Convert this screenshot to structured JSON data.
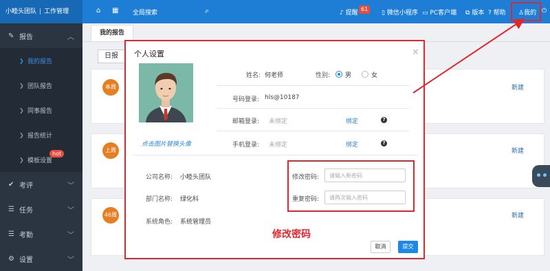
{
  "topbar": {
    "brand": "小睦头团队",
    "brand_sub": "工作管理",
    "search_label": "全局搜索",
    "remind_label": "提醒",
    "remind_count": "61",
    "wechat_label": "微信小程序",
    "pc_label": "PC客户端",
    "version_label": "版本",
    "help_label": "帮助",
    "mine_label": "我的"
  },
  "sidebar": {
    "groups": [
      {
        "label": "报告",
        "icon": "edit-icon"
      },
      {
        "label": "考评",
        "icon": "check-icon"
      },
      {
        "label": "任务",
        "icon": "list-icon"
      },
      {
        "label": "考勤",
        "icon": "list-icon"
      },
      {
        "label": "设置",
        "icon": "gear-icon"
      }
    ],
    "sub_items": [
      "我的报告",
      "团队报告",
      "同事报告",
      "报告统计",
      "模板设置"
    ],
    "hot_badge": "hot"
  },
  "main": {
    "tab": "我的报告",
    "daily_button": "日报",
    "cards": [
      {
        "week": "本周",
        "action": "新建"
      },
      {
        "week": "上周",
        "action": "新建"
      },
      {
        "week": "46周",
        "action": "新建"
      }
    ]
  },
  "modal": {
    "title": "个人设置",
    "avatar_hint": "点击图片替换头像",
    "name_label": "姓名:",
    "name_value": "何老师",
    "gender_label": "性别:",
    "gender_male": "男",
    "gender_female": "女",
    "gender_selected": "男",
    "phone_login_label": "号码登录:",
    "phone_login_value": "hls@10187",
    "email_login_label": "邮箱登录:",
    "email_login_value": "未绑定",
    "mobile_login_label": "手机登录:",
    "mobile_login_value": "未绑定",
    "bind_label": "绑定",
    "help_mark": "?",
    "company_label": "公司名称:",
    "company_value": "小睦头团队",
    "dept_label": "部门名称:",
    "dept_value": "绿化科",
    "role_label": "系统角色:",
    "role_value": "系统管理员",
    "new_pw_label": "修改密码:",
    "new_pw_placeholder": "请输入新密码",
    "repeat_pw_label": "重复密码:",
    "repeat_pw_placeholder": "请再次输入密码",
    "cancel": "取消",
    "submit": "提交"
  },
  "annotation": {
    "text": "修改密码",
    "color": "#e4262c"
  },
  "colors": {
    "topbar": "#1e7ed6",
    "sidebar": "#2b3541",
    "primary": "#1e88e5",
    "highlight": "#e4262c"
  }
}
